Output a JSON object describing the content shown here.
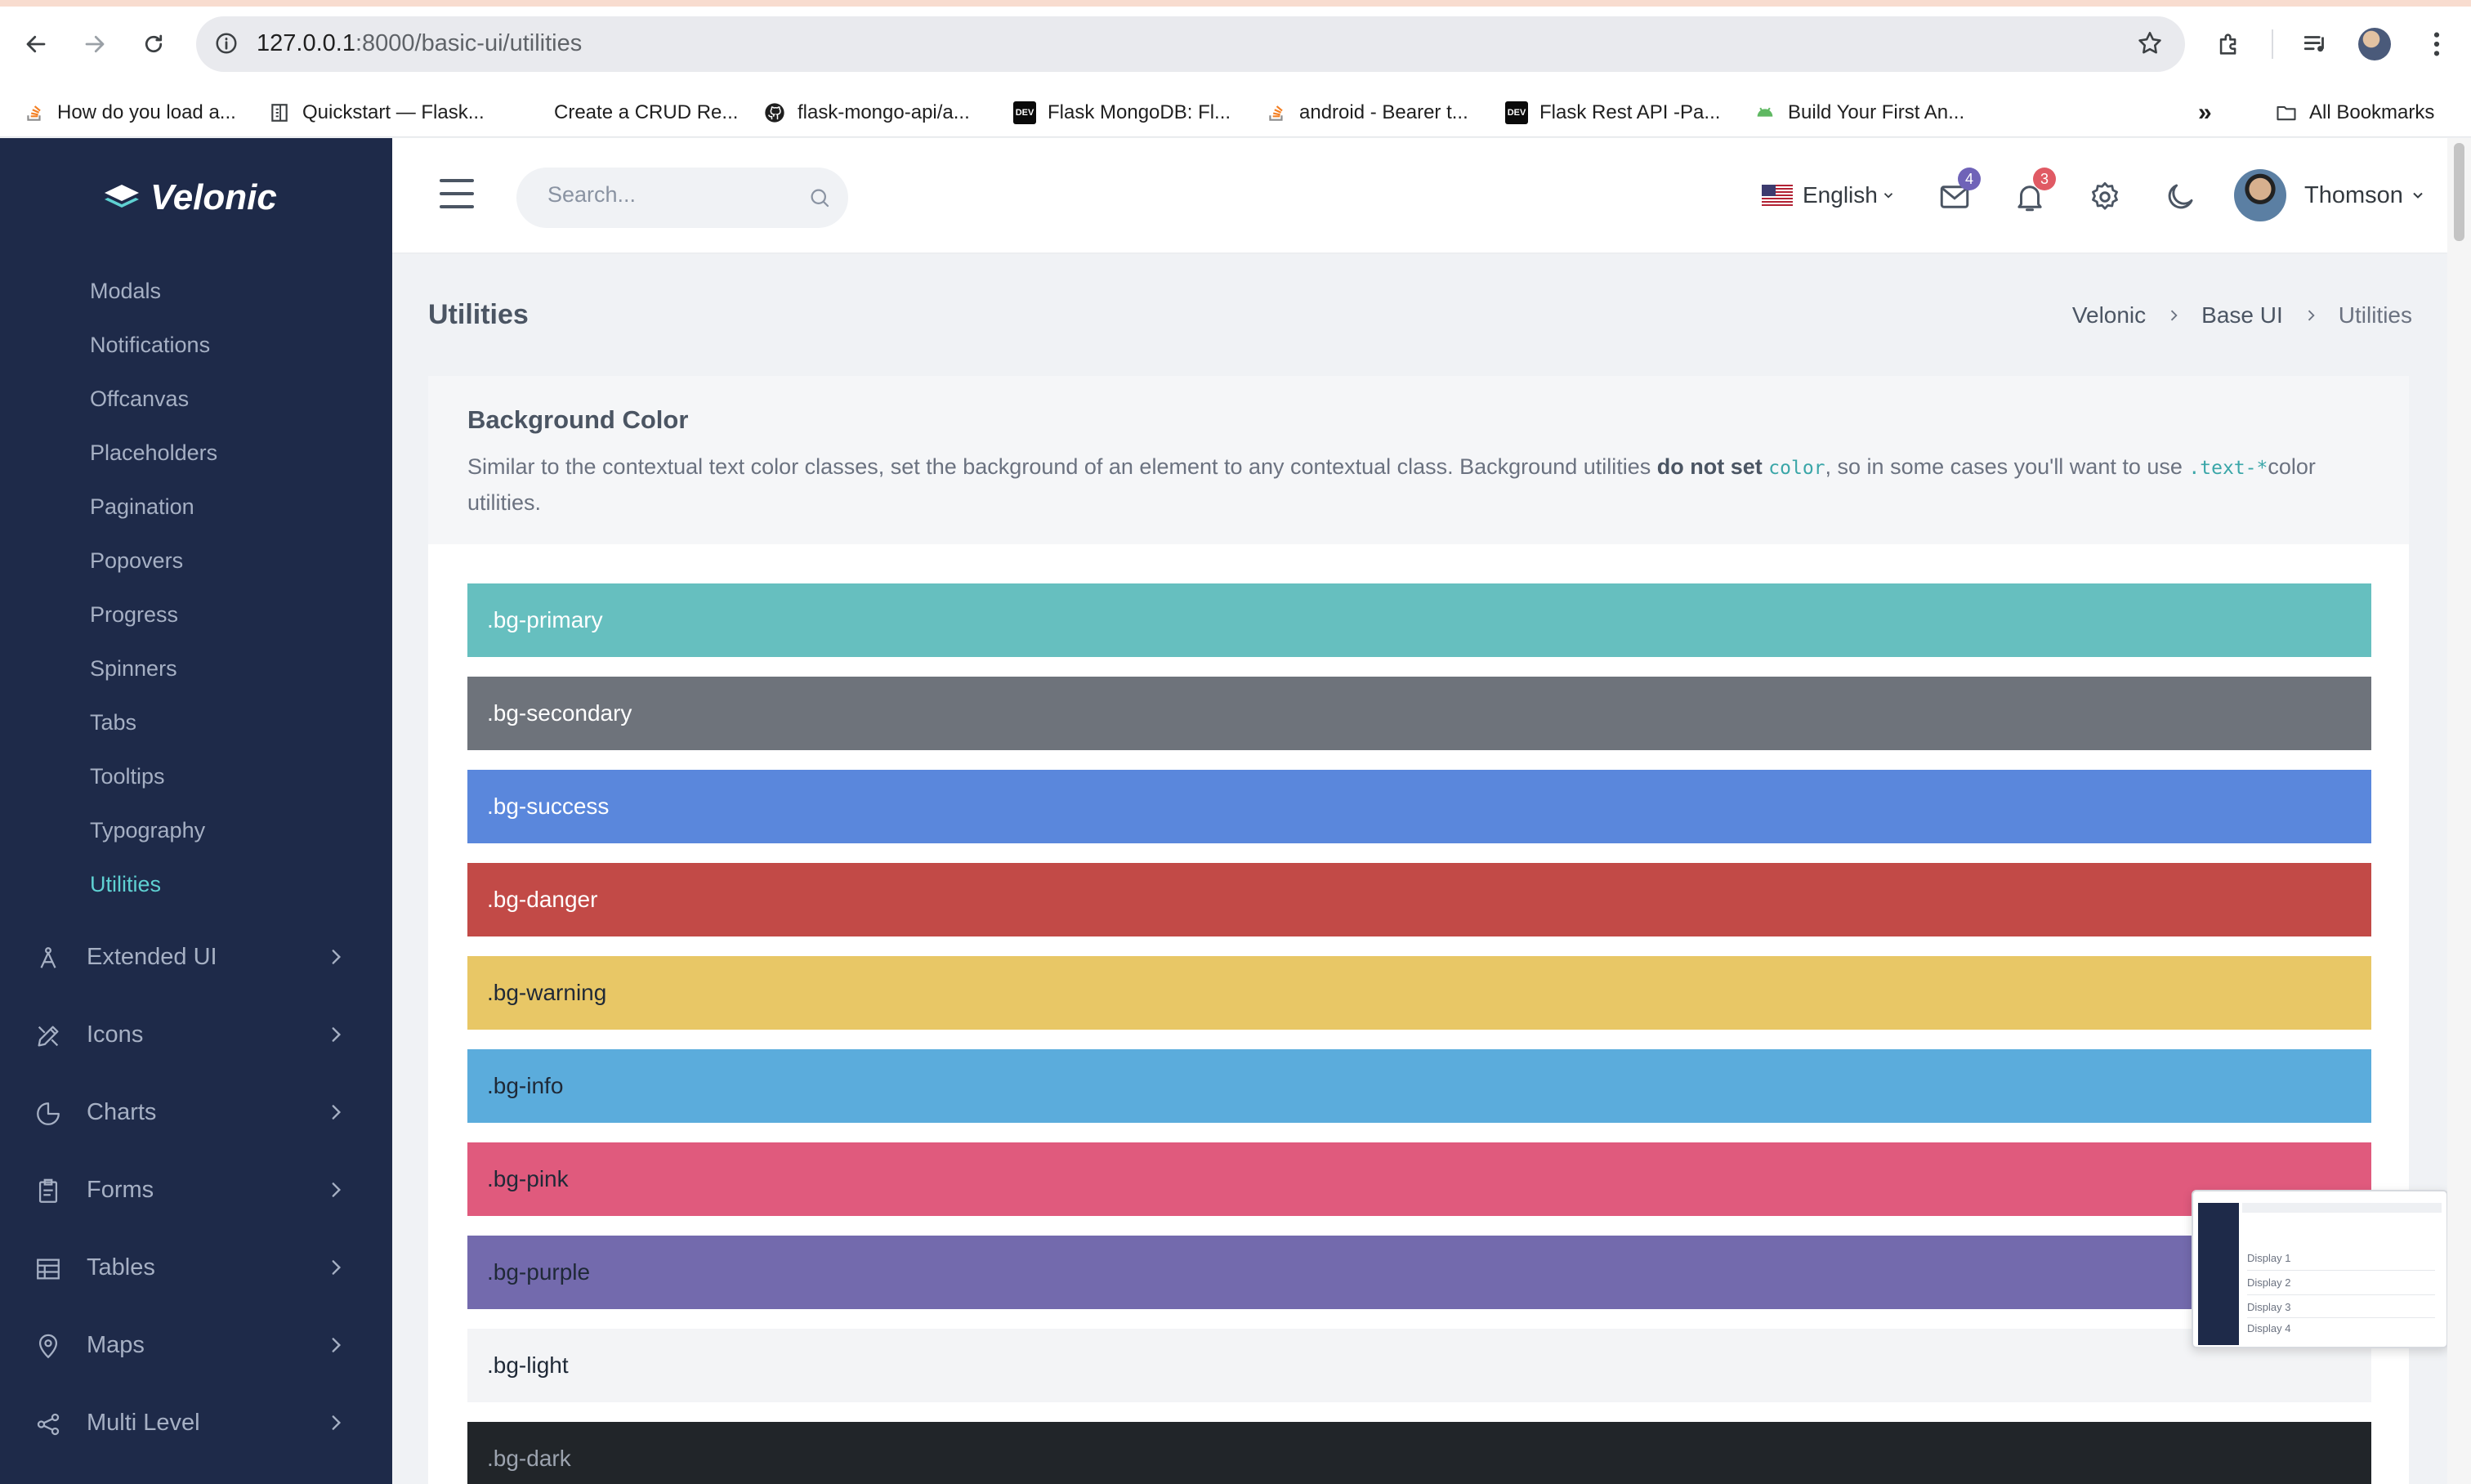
{
  "browser": {
    "url_host": "127.0.0.1",
    "url_rest": ":8000/basic-ui/utilities",
    "bookmarks": [
      {
        "label": "How do you load a...",
        "icon": "stackoverflow-icon"
      },
      {
        "label": "Quickstart — Flask...",
        "icon": "document-icon"
      },
      {
        "label": "Create a CRUD Re...",
        "icon": ""
      },
      {
        "label": "flask-mongo-api/a...",
        "icon": "github-icon"
      },
      {
        "label": "Flask MongoDB: Fl...",
        "icon": "dev-icon"
      },
      {
        "label": "android - Bearer t...",
        "icon": "stackoverflow-icon"
      },
      {
        "label": "Flask Rest API -Pa...",
        "icon": "dev-icon"
      },
      {
        "label": "Build Your First An...",
        "icon": "android-icon"
      }
    ],
    "all_bookmarks": "All Bookmarks",
    "more_glyph": "»"
  },
  "sidebar": {
    "logo": "Velonic",
    "sub_items": [
      {
        "label": "Modals",
        "active": false
      },
      {
        "label": "Notifications",
        "active": false
      },
      {
        "label": "Offcanvas",
        "active": false
      },
      {
        "label": "Placeholders",
        "active": false
      },
      {
        "label": "Pagination",
        "active": false
      },
      {
        "label": "Popovers",
        "active": false
      },
      {
        "label": "Progress",
        "active": false
      },
      {
        "label": "Spinners",
        "active": false
      },
      {
        "label": "Tabs",
        "active": false
      },
      {
        "label": "Tooltips",
        "active": false
      },
      {
        "label": "Typography",
        "active": false
      },
      {
        "label": "Utilities",
        "active": true
      }
    ],
    "menu": [
      {
        "label": "Extended UI",
        "icon": "extended-ui-icon"
      },
      {
        "label": "Icons",
        "icon": "icons-icon"
      },
      {
        "label": "Charts",
        "icon": "charts-icon"
      },
      {
        "label": "Forms",
        "icon": "forms-icon"
      },
      {
        "label": "Tables",
        "icon": "tables-icon"
      },
      {
        "label": "Maps",
        "icon": "maps-icon"
      },
      {
        "label": "Multi Level",
        "icon": "multi-level-icon"
      }
    ]
  },
  "topbar": {
    "search_placeholder": "Search...",
    "language": "English",
    "mail_badge": "4",
    "notification_badge": "3",
    "user_name": "Thomson"
  },
  "page": {
    "title": "Utilities",
    "breadcrumb": [
      "Velonic",
      "Base UI",
      "Utilities"
    ]
  },
  "card": {
    "title": "Background Color",
    "desc_1": "Similar to the contextual text color classes, set the background of an element to any contextual class. Background utilities ",
    "desc_bold": "do not set ",
    "desc_code1": "color",
    "desc_2": ", so in some cases you'll want to use ",
    "desc_code2": ".text-*",
    "desc_3": "color utilities.",
    "rows": [
      {
        "label": ".bg-primary",
        "bg": "#66bfbf",
        "fg": "#ffffff"
      },
      {
        "label": ".bg-secondary",
        "bg": "#6e737b",
        "fg": "#ffffff"
      },
      {
        "label": ".bg-success",
        "bg": "#5a87dc",
        "fg": "#ffffff"
      },
      {
        "label": ".bg-danger",
        "bg": "#c24a47",
        "fg": "#ffffff"
      },
      {
        "label": ".bg-warning",
        "bg": "#e8c766",
        "fg": "#1f2937"
      },
      {
        "label": ".bg-info",
        "bg": "#5bacdc",
        "fg": "#1f2937"
      },
      {
        "label": ".bg-pink",
        "bg": "#e05a7d",
        "fg": "#1f2937"
      },
      {
        "label": ".bg-purple",
        "bg": "#736aad",
        "fg": "#1f2937"
      },
      {
        "label": ".bg-light",
        "bg": "#f3f4f6",
        "fg": "#1f2937"
      },
      {
        "label": ".bg-dark",
        "bg": "#212529",
        "fg": "#9ca3af"
      }
    ]
  },
  "thumbnail": {
    "lines": [
      "Display 1",
      "Display 2",
      "Display 3",
      "Display 4"
    ]
  },
  "colors": {
    "sidebar_bg": "#1e2a49",
    "accent": "#5fd1d2",
    "mail_badge": "#6f63b8",
    "notification_badge": "#e05a64"
  }
}
